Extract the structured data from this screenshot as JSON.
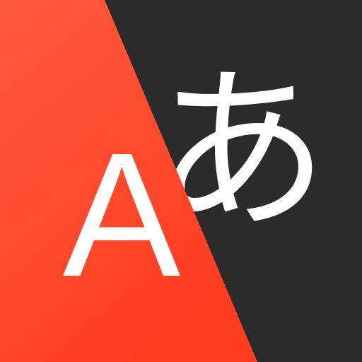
{
  "icon": {
    "name": "translate-icon",
    "latin_glyph": "A",
    "japanese_glyph": "あ",
    "colors": {
      "red_light": "#FF5A3F",
      "red_dark": "#FF3D1F",
      "dark_panel": "#2B2B2B",
      "glyph": "#FFFFFF"
    }
  }
}
